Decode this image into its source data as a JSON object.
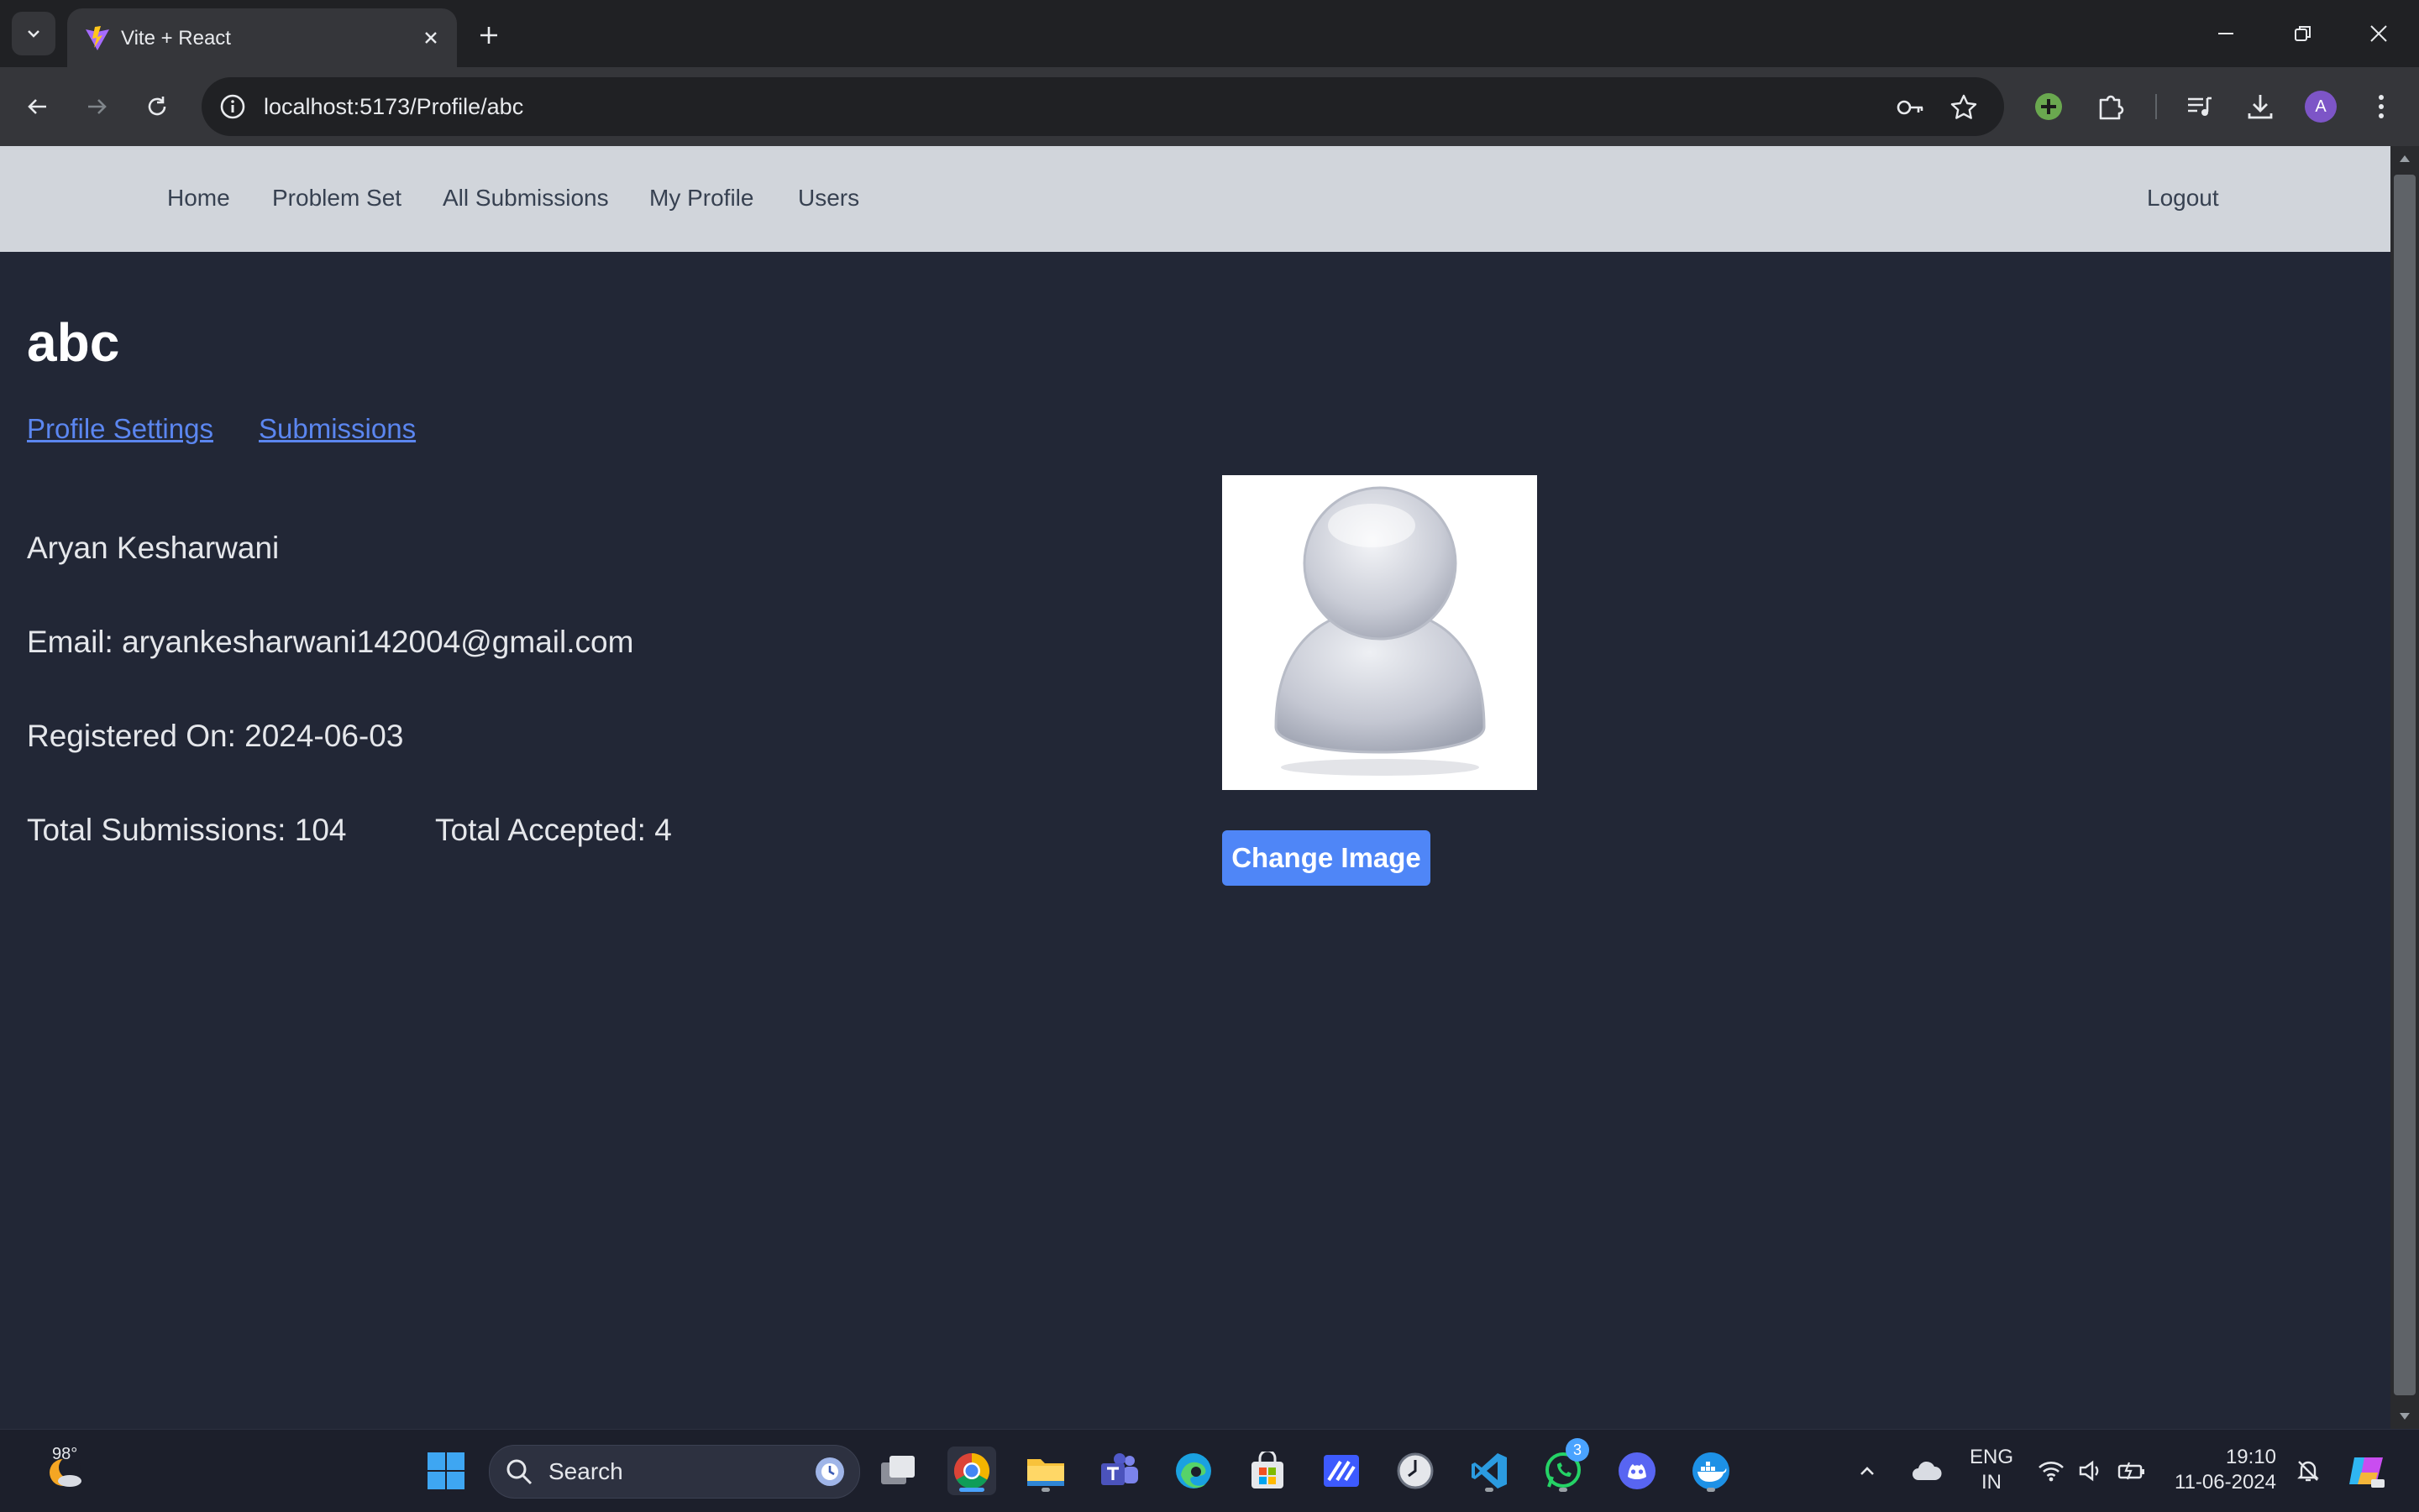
{
  "browser": {
    "tab_title": "Vite + React",
    "url": "localhost:5173/Profile/abc"
  },
  "nav": {
    "links": [
      "Home",
      "Problem Set",
      "All Submissions",
      "My Profile",
      "Users"
    ],
    "logout": "Logout"
  },
  "profile": {
    "username": "abc",
    "tabs": [
      "Profile Settings",
      "Submissions"
    ],
    "full_name": "Aryan Kesharwani",
    "email": "Email: aryankesharwani142004@gmail.com",
    "registered": "Registered On: 2024-06-03",
    "total_submissions": "Total Submissions: 104",
    "total_accepted": "Total Accepted: 4",
    "change_image_label": "Change Image"
  },
  "taskbar": {
    "weather_temp": "98°",
    "search_placeholder": "Search",
    "whatsapp_badge": "3",
    "lang_line1": "ENG",
    "lang_line2": "IN",
    "time": "19:10",
    "date": "11-06-2024"
  },
  "colors": {
    "page_bg": "#222736",
    "nav_bg": "#d1d5db",
    "link": "#5b86f0",
    "button": "#4f86f7"
  }
}
